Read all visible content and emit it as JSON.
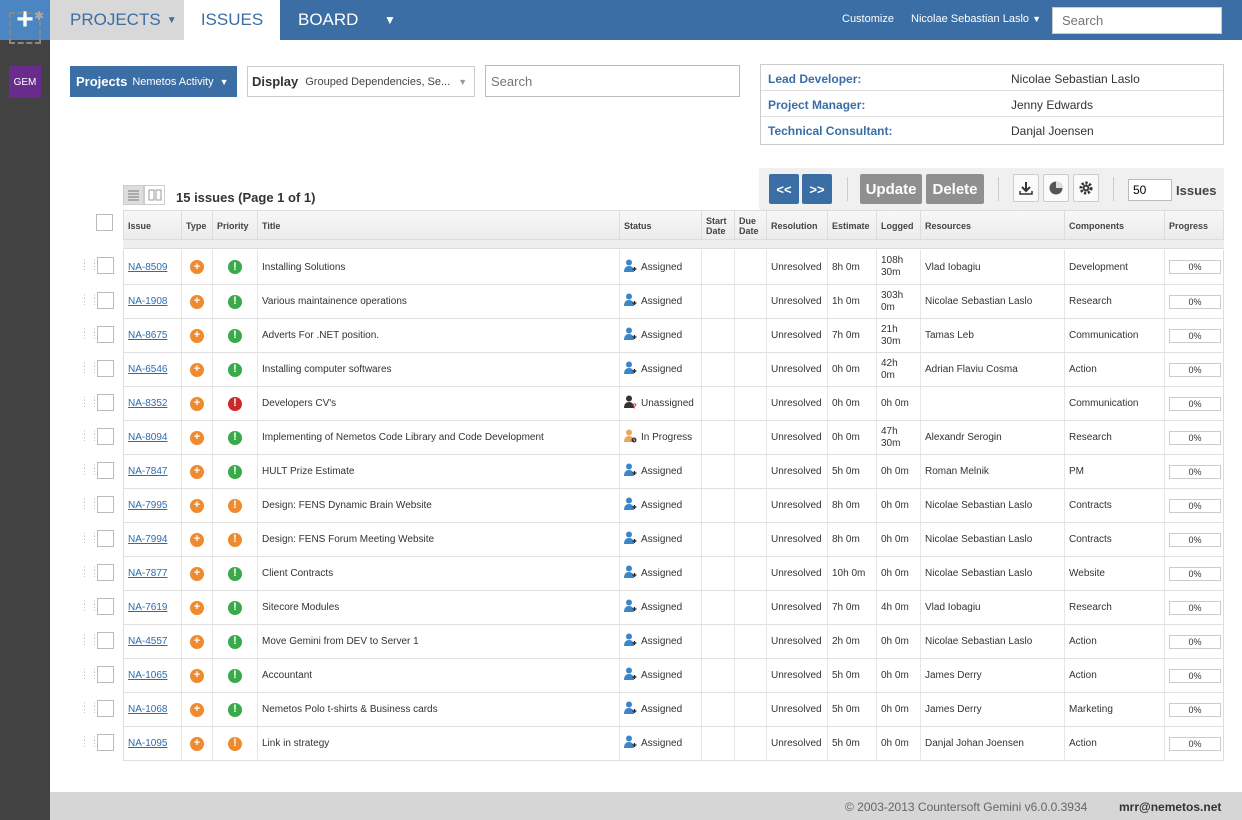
{
  "topnav": {
    "projects": "PROJECTS",
    "issues": "ISSUES",
    "board": "BOARD",
    "customize": "Customize",
    "user": "Nicolae Sebastian Laslo",
    "search_placeholder": "Search"
  },
  "sidebar": {
    "gem_label": "GEM"
  },
  "filters": {
    "projects_label": "Projects",
    "projects_value": "Nemetos Activity",
    "display_label": "Display",
    "display_value": "Grouped Dependencies, Se...",
    "search_placeholder": "Search"
  },
  "people": [
    {
      "role": "Lead Developer:",
      "name": "Nicolae Sebastian Laslo"
    },
    {
      "role": "Project Manager:",
      "name": "Jenny Edwards"
    },
    {
      "role": "Technical Consultant:",
      "name": "Danjal Joensen"
    }
  ],
  "toolbar": {
    "prev": "<<",
    "next": ">>",
    "update": "Update",
    "delete": "Delete",
    "page_size": "50",
    "issues_label": "Issues"
  },
  "summary": "15 issues (Page 1 of 1)",
  "columns": [
    "Issue",
    "Type",
    "Priority",
    "Title",
    "Status",
    "Start Date",
    "Due Date",
    "Resolution",
    "Estimate",
    "Logged",
    "Resources",
    "Components",
    "Progress"
  ],
  "colors": {
    "accent": "#3a6ea5",
    "priority_green": "#3aa94a",
    "priority_red": "#cc2a2a",
    "priority_orange": "#ef8a2f",
    "type_orange": "#ef8a2f"
  },
  "rows": [
    {
      "key": "NA-8509",
      "priority": "green",
      "title": "Installing Solutions",
      "status": "Assigned",
      "status_icon": "assigned",
      "resolution": "Unresolved",
      "estimate": "8h 0m",
      "logged": "108h 30m",
      "resources": "Vlad Iobagiu",
      "components": "Development",
      "progress": "0%"
    },
    {
      "key": "NA-1908",
      "priority": "green",
      "title": "Various maintainence operations",
      "status": "Assigned",
      "status_icon": "assigned",
      "resolution": "Unresolved",
      "estimate": "1h 0m",
      "logged": "303h 0m",
      "resources": "Nicolae Sebastian Laslo",
      "components": "Research",
      "progress": "0%"
    },
    {
      "key": "NA-8675",
      "priority": "green",
      "title": "Adverts For .NET position.",
      "status": "Assigned",
      "status_icon": "assigned",
      "resolution": "Unresolved",
      "estimate": "7h 0m",
      "logged": "21h 30m",
      "resources": "Tamas Leb",
      "components": "Communication",
      "progress": "0%"
    },
    {
      "key": "NA-6546",
      "priority": "green",
      "title": "Installing computer softwares",
      "status": "Assigned",
      "status_icon": "assigned",
      "resolution": "Unresolved",
      "estimate": "0h 0m",
      "logged": "42h 0m",
      "resources": "Adrian Flaviu Cosma",
      "components": "Action",
      "progress": "0%"
    },
    {
      "key": "NA-8352",
      "priority": "red",
      "title": "Developers CV's",
      "status": "Unassigned",
      "status_icon": "unassigned",
      "resolution": "Unresolved",
      "estimate": "0h 0m",
      "logged": "0h 0m",
      "resources": "",
      "components": "Communication",
      "progress": "0%"
    },
    {
      "key": "NA-8094",
      "priority": "green",
      "title": "Implementing of Nemetos Code Library and Code Development",
      "status": "In Progress",
      "status_icon": "inprogress",
      "resolution": "Unresolved",
      "estimate": "0h 0m",
      "logged": "47h 30m",
      "resources": "Alexandr Serogin",
      "components": "Research",
      "progress": "0%"
    },
    {
      "key": "NA-7847",
      "priority": "green",
      "title": "HULT Prize Estimate",
      "status": "Assigned",
      "status_icon": "assigned",
      "resolution": "Unresolved",
      "estimate": "5h 0m",
      "logged": "0h 0m",
      "resources": "Roman Melnik",
      "components": "PM",
      "progress": "0%"
    },
    {
      "key": "NA-7995",
      "priority": "orange",
      "title": "Design: FENS Dynamic Brain Website",
      "status": "Assigned",
      "status_icon": "assigned",
      "resolution": "Unresolved",
      "estimate": "8h 0m",
      "logged": "0h 0m",
      "resources": "Nicolae Sebastian Laslo",
      "components": "Contracts",
      "progress": "0%"
    },
    {
      "key": "NA-7994",
      "priority": "orange",
      "title": "Design: FENS Forum Meeting Website",
      "status": "Assigned",
      "status_icon": "assigned",
      "resolution": "Unresolved",
      "estimate": "8h 0m",
      "logged": "0h 0m",
      "resources": "Nicolae Sebastian Laslo",
      "components": "Contracts",
      "progress": "0%"
    },
    {
      "key": "NA-7877",
      "priority": "green",
      "title": "Client Contracts",
      "status": "Assigned",
      "status_icon": "assigned",
      "resolution": "Unresolved",
      "estimate": "10h 0m",
      "logged": "0h 0m",
      "resources": "Nicolae Sebastian Laslo",
      "components": "Website",
      "progress": "0%"
    },
    {
      "key": "NA-7619",
      "priority": "green",
      "title": "Sitecore Modules",
      "status": "Assigned",
      "status_icon": "assigned",
      "resolution": "Unresolved",
      "estimate": "7h 0m",
      "logged": "4h 0m",
      "resources": "Vlad Iobagiu",
      "components": "Research",
      "progress": "0%"
    },
    {
      "key": "NA-4557",
      "priority": "green",
      "title": "Move Gemini from DEV to Server 1",
      "status": "Assigned",
      "status_icon": "assigned",
      "resolution": "Unresolved",
      "estimate": "2h 0m",
      "logged": "0h 0m",
      "resources": "Nicolae Sebastian Laslo",
      "components": "Action",
      "progress": "0%"
    },
    {
      "key": "NA-1065",
      "priority": "green",
      "title": "Accountant",
      "status": "Assigned",
      "status_icon": "assigned",
      "resolution": "Unresolved",
      "estimate": "5h 0m",
      "logged": "0h 0m",
      "resources": "James Derry",
      "components": "Action",
      "progress": "0%"
    },
    {
      "key": "NA-1068",
      "priority": "green",
      "title": "Nemetos Polo t-shirts & Business cards",
      "status": "Assigned",
      "status_icon": "assigned",
      "resolution": "Unresolved",
      "estimate": "5h 0m",
      "logged": "0h 0m",
      "resources": "James Derry",
      "components": "Marketing",
      "progress": "0%"
    },
    {
      "key": "NA-1095",
      "priority": "orange",
      "title": "Link in strategy",
      "status": "Assigned",
      "status_icon": "assigned",
      "resolution": "Unresolved",
      "estimate": "5h 0m",
      "logged": "0h 0m",
      "resources": "Danjal Johan Joensen",
      "components": "Action",
      "progress": "0%"
    }
  ],
  "footer": {
    "copyright": "© 2003-2013 Countersoft Gemini v6.0.0.3934",
    "user_email": "mrr@nemetos.net"
  }
}
